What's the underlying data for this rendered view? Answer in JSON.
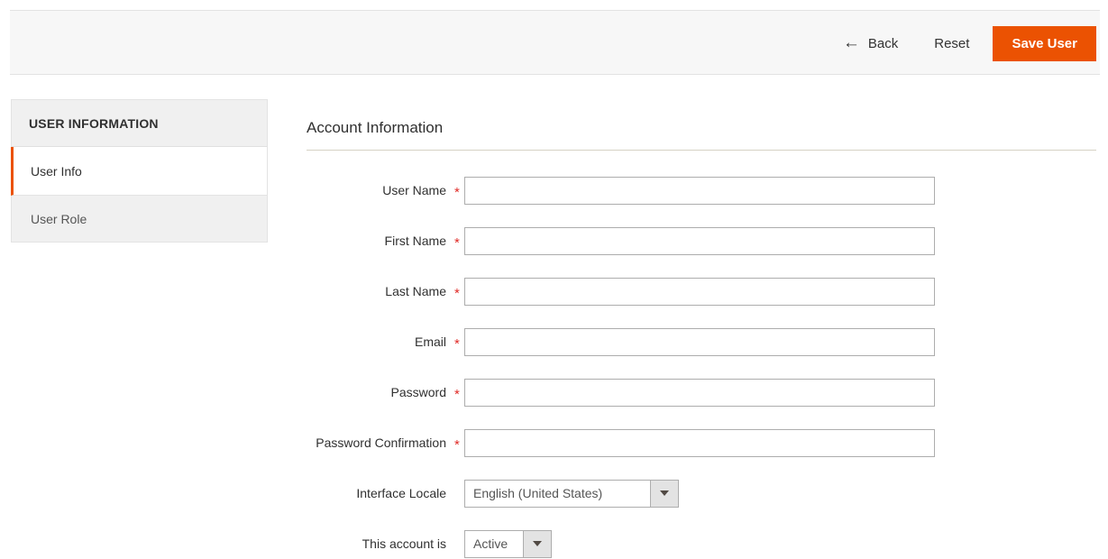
{
  "header": {
    "back_label": "Back",
    "back_icon": "arrow-left-icon",
    "back_glyph": "←",
    "reset_label": "Reset",
    "save_label": "Save User",
    "accent_color": "#eb5202",
    "bar_background": "#f7f7f7"
  },
  "sidebar": {
    "title": "USER INFORMATION",
    "items": [
      {
        "label": "User Info",
        "active": true
      },
      {
        "label": "User Role",
        "active": false
      }
    ]
  },
  "main": {
    "section_title": "Account Information",
    "required_marker": "*",
    "fields": [
      {
        "label": "User Name",
        "required": true,
        "type": "text",
        "value": ""
      },
      {
        "label": "First Name",
        "required": true,
        "type": "text",
        "value": ""
      },
      {
        "label": "Last Name",
        "required": true,
        "type": "text",
        "value": ""
      },
      {
        "label": "Email",
        "required": true,
        "type": "text",
        "value": ""
      },
      {
        "label": "Password",
        "required": true,
        "type": "password",
        "value": ""
      },
      {
        "label": "Password Confirmation",
        "required": true,
        "type": "password",
        "value": ""
      },
      {
        "label": "Interface Locale",
        "required": false,
        "type": "select",
        "value": "English (United States)"
      },
      {
        "label": "This account is",
        "required": false,
        "type": "select",
        "value": "Active"
      }
    ]
  }
}
